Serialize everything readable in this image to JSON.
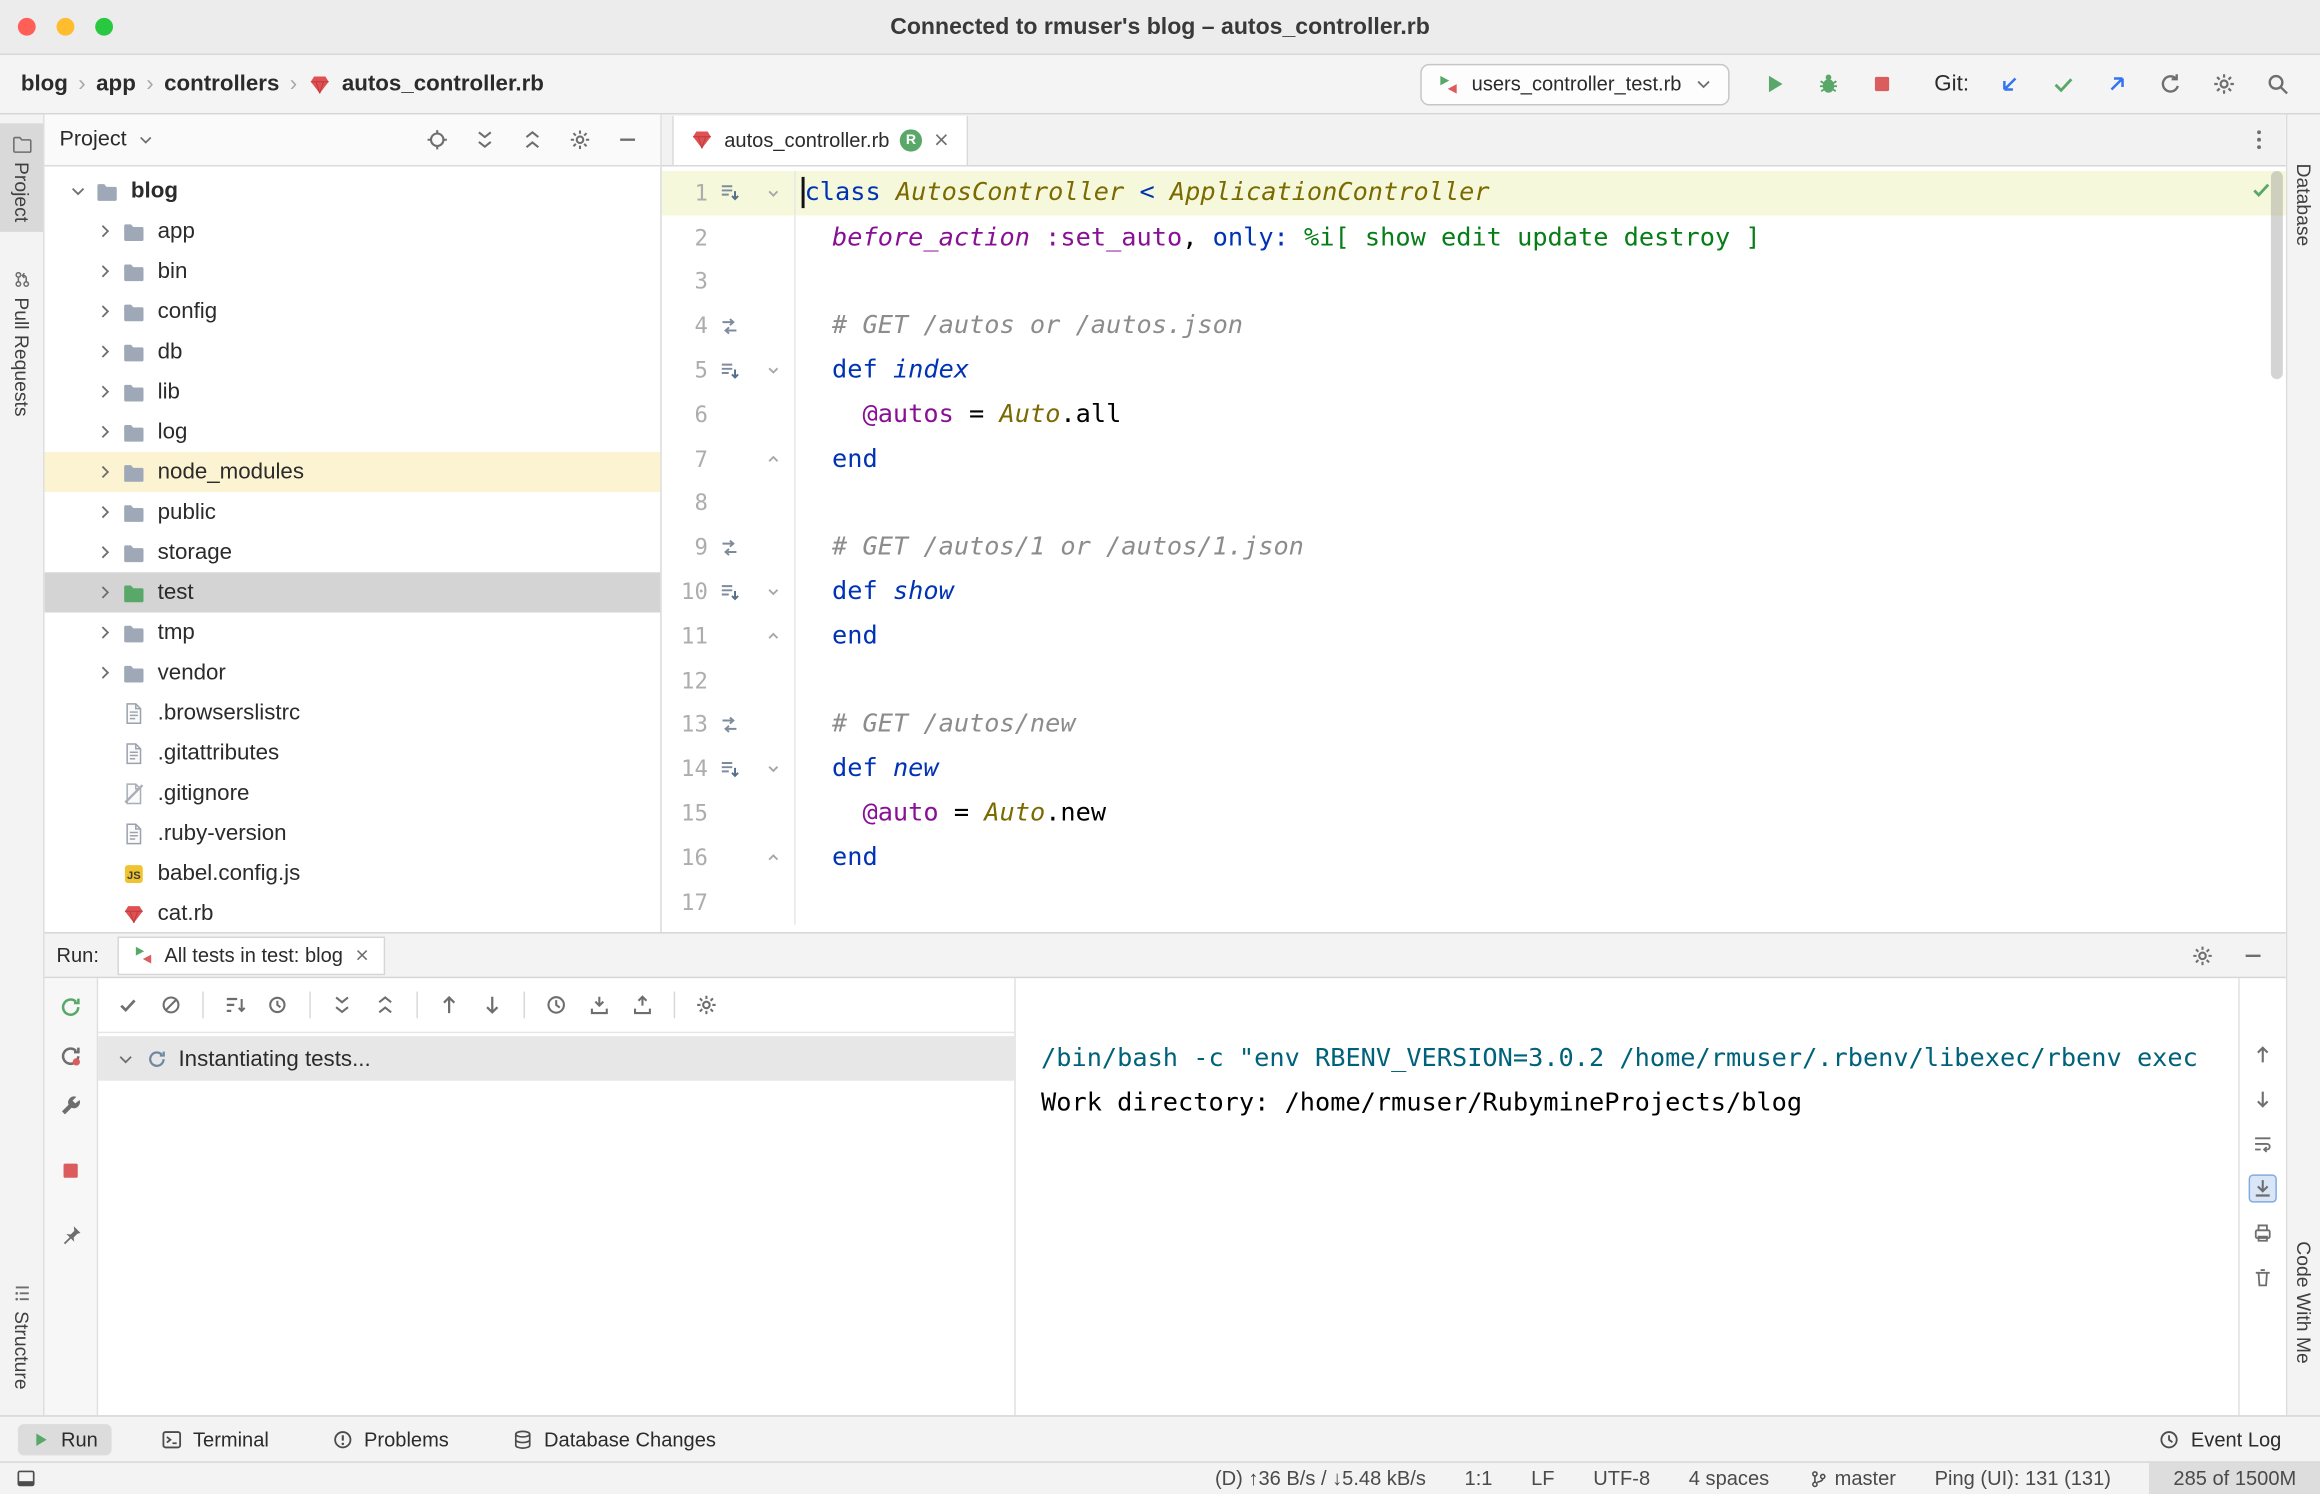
{
  "window": {
    "title": "Connected to rmuser's blog – autos_controller.rb"
  },
  "toolbar": {
    "breadcrumbs": [
      "blog",
      "app",
      "controllers"
    ],
    "crumb_sep": "›",
    "breadcrumb_file": "autos_controller.rb",
    "run_config": "users_controller_test.rb",
    "git_label": "Git:"
  },
  "stripes": {
    "project": "Project",
    "pull_requests": "Pull Requests",
    "structure": "Structure",
    "database": "Database",
    "code_with_me": "Code With Me"
  },
  "project": {
    "header": "Project",
    "tree": [
      {
        "label": "blog",
        "indent": 0,
        "chevron": "down",
        "icon": "folder",
        "bold": true
      },
      {
        "label": "app",
        "indent": 1,
        "chevron": "right",
        "icon": "folder"
      },
      {
        "label": "bin",
        "indent": 1,
        "chevron": "right",
        "icon": "folder"
      },
      {
        "label": "config",
        "indent": 1,
        "chevron": "right",
        "icon": "folder"
      },
      {
        "label": "db",
        "indent": 1,
        "chevron": "right",
        "icon": "folder"
      },
      {
        "label": "lib",
        "indent": 1,
        "chevron": "right",
        "icon": "folder"
      },
      {
        "label": "log",
        "indent": 1,
        "chevron": "right",
        "icon": "folder"
      },
      {
        "label": "node_modules",
        "indent": 1,
        "chevron": "right",
        "icon": "folder",
        "highlight": "excluded"
      },
      {
        "label": "public",
        "indent": 1,
        "chevron": "right",
        "icon": "folder"
      },
      {
        "label": "storage",
        "indent": 1,
        "chevron": "right",
        "icon": "folder"
      },
      {
        "label": "test",
        "indent": 1,
        "chevron": "right",
        "icon": "folder-test",
        "selected": true
      },
      {
        "label": "tmp",
        "indent": 1,
        "chevron": "right",
        "icon": "folder"
      },
      {
        "label": "vendor",
        "indent": 1,
        "chevron": "right",
        "icon": "folder"
      },
      {
        "label": ".browserslistrc",
        "indent": 1,
        "icon": "file-text"
      },
      {
        "label": ".gitattributes",
        "indent": 1,
        "icon": "file-text"
      },
      {
        "label": ".gitignore",
        "indent": 1,
        "icon": "file-ignored"
      },
      {
        "label": ".ruby-version",
        "indent": 1,
        "icon": "file-text"
      },
      {
        "label": "babel.config.js",
        "indent": 1,
        "icon": "file-js"
      },
      {
        "label": "cat.rb",
        "indent": 1,
        "icon": "file-ruby"
      }
    ]
  },
  "editor": {
    "tab": {
      "label": "autos_controller.rb",
      "badge": "R"
    },
    "lines": [
      {
        "n": 1,
        "gutter": "actions",
        "fold": "down",
        "caret": true,
        "segs": [
          [
            "kw",
            "class "
          ],
          [
            "const",
            "AutosController"
          ],
          [
            "kw",
            " < "
          ],
          [
            "const",
            "ApplicationController"
          ]
        ]
      },
      {
        "n": 2,
        "segs": [
          [
            "plain",
            "  "
          ],
          [
            "call",
            "before_action"
          ],
          [
            "plain",
            " "
          ],
          [
            "sym",
            ":set_auto"
          ],
          [
            "plain",
            ", "
          ],
          [
            "kw",
            "only:"
          ],
          [
            "plain",
            " "
          ],
          [
            "str",
            "%i[ show edit update destroy ]"
          ]
        ]
      },
      {
        "n": 3,
        "segs": []
      },
      {
        "n": 4,
        "gutter": "route",
        "segs": [
          [
            "plain",
            "  "
          ],
          [
            "cmt",
            "# GET /autos or /autos.json"
          ]
        ]
      },
      {
        "n": 5,
        "gutter": "actions",
        "fold": "down",
        "segs": [
          [
            "plain",
            "  "
          ],
          [
            "kw",
            "def "
          ],
          [
            "decl",
            "index"
          ]
        ]
      },
      {
        "n": 6,
        "segs": [
          [
            "plain",
            "    "
          ],
          [
            "ivar",
            "@autos"
          ],
          [
            "plain",
            " = "
          ],
          [
            "const",
            "Auto"
          ],
          [
            "plain",
            ".all"
          ]
        ]
      },
      {
        "n": 7,
        "fold": "up",
        "segs": [
          [
            "plain",
            "  "
          ],
          [
            "kw",
            "end"
          ]
        ]
      },
      {
        "n": 8,
        "segs": []
      },
      {
        "n": 9,
        "gutter": "route",
        "segs": [
          [
            "plain",
            "  "
          ],
          [
            "cmt",
            "# GET /autos/1 or /autos/1.json"
          ]
        ]
      },
      {
        "n": 10,
        "gutter": "actions",
        "fold": "down",
        "segs": [
          [
            "plain",
            "  "
          ],
          [
            "kw",
            "def "
          ],
          [
            "decl",
            "show"
          ]
        ]
      },
      {
        "n": 11,
        "fold": "up",
        "segs": [
          [
            "plain",
            "  "
          ],
          [
            "kw",
            "end"
          ]
        ]
      },
      {
        "n": 12,
        "segs": []
      },
      {
        "n": 13,
        "gutter": "route",
        "segs": [
          [
            "plain",
            "  "
          ],
          [
            "cmt",
            "# GET /autos/new"
          ]
        ]
      },
      {
        "n": 14,
        "gutter": "actions",
        "fold": "down",
        "segs": [
          [
            "plain",
            "  "
          ],
          [
            "kw",
            "def "
          ],
          [
            "decl",
            "new"
          ]
        ]
      },
      {
        "n": 15,
        "segs": [
          [
            "plain",
            "    "
          ],
          [
            "ivar",
            "@auto"
          ],
          [
            "plain",
            " = "
          ],
          [
            "const",
            "Auto"
          ],
          [
            "plain",
            ".new"
          ]
        ]
      },
      {
        "n": 16,
        "fold": "up",
        "segs": [
          [
            "plain",
            "  "
          ],
          [
            "kw",
            "end"
          ]
        ]
      },
      {
        "n": 17,
        "segs": []
      }
    ]
  },
  "run_panel": {
    "label": "Run:",
    "tab": "All tests in test: blog",
    "tree_item": "Instantiating tests...",
    "console": [
      {
        "t": "/bin/bash -c \"env RBENV_VERSION=3.0.2 /home/rmuser/.rbenv/libexec/rbenv exec",
        "c": "teal"
      },
      {
        "t": "Work directory: /home/rmuser/RubymineProjects/blog",
        "c": "plain"
      }
    ]
  },
  "bottom_bar": {
    "items": [
      "Run",
      "Terminal",
      "Problems",
      "Database Changes"
    ],
    "event_log": "Event Log"
  },
  "status_bar": {
    "network": "(D) ↑36 B/s / ↓5.48 kB/s",
    "caret": "1:1",
    "line_sep": "LF",
    "encoding": "UTF-8",
    "indent": "4 spaces",
    "branch": "master",
    "ping": "Ping (UI): 131 (131)",
    "memory": "285 of 1500M"
  },
  "colors": {
    "kw": "#0033B3",
    "const": "#7A6A00",
    "call": "#871094",
    "sym": "#871094",
    "str": "#067D17",
    "cmt": "#8C8C8C",
    "decl": "#0033B3",
    "ivar": "#871094",
    "accent_green": "#59A869",
    "accent_red": "#DB5C5C",
    "accent_blue": "#3574F0"
  }
}
